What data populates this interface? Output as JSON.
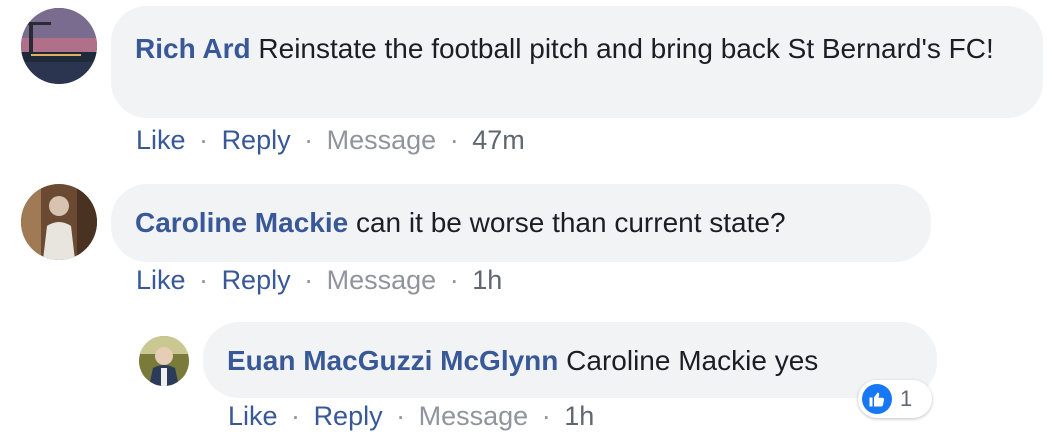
{
  "comments": [
    {
      "author": "Rich Ard",
      "text": "Reinstate the football pitch and bring back St Bernard's FC!",
      "actions": {
        "like": "Like",
        "reply": "Reply",
        "message": "Message",
        "time": "47m"
      }
    },
    {
      "author": "Caroline Mackie",
      "text": "can it be worse than current state?",
      "actions": {
        "like": "Like",
        "reply": "Reply",
        "message": "Message",
        "time": "1h"
      }
    }
  ],
  "reply": {
    "author": "Euan MacGuzzi McGlynn",
    "text": "Caroline Mackie yes",
    "actions": {
      "like": "Like",
      "reply": "Reply",
      "message": "Message",
      "time": "1h"
    },
    "reaction": {
      "icon": "thumbs-up-icon",
      "count": "1"
    }
  },
  "separator": "·",
  "colors": {
    "author_link": "#385898",
    "bubble_bg": "#f2f3f5",
    "like_badge": "#1877f2",
    "muted_text": "#90949c"
  }
}
